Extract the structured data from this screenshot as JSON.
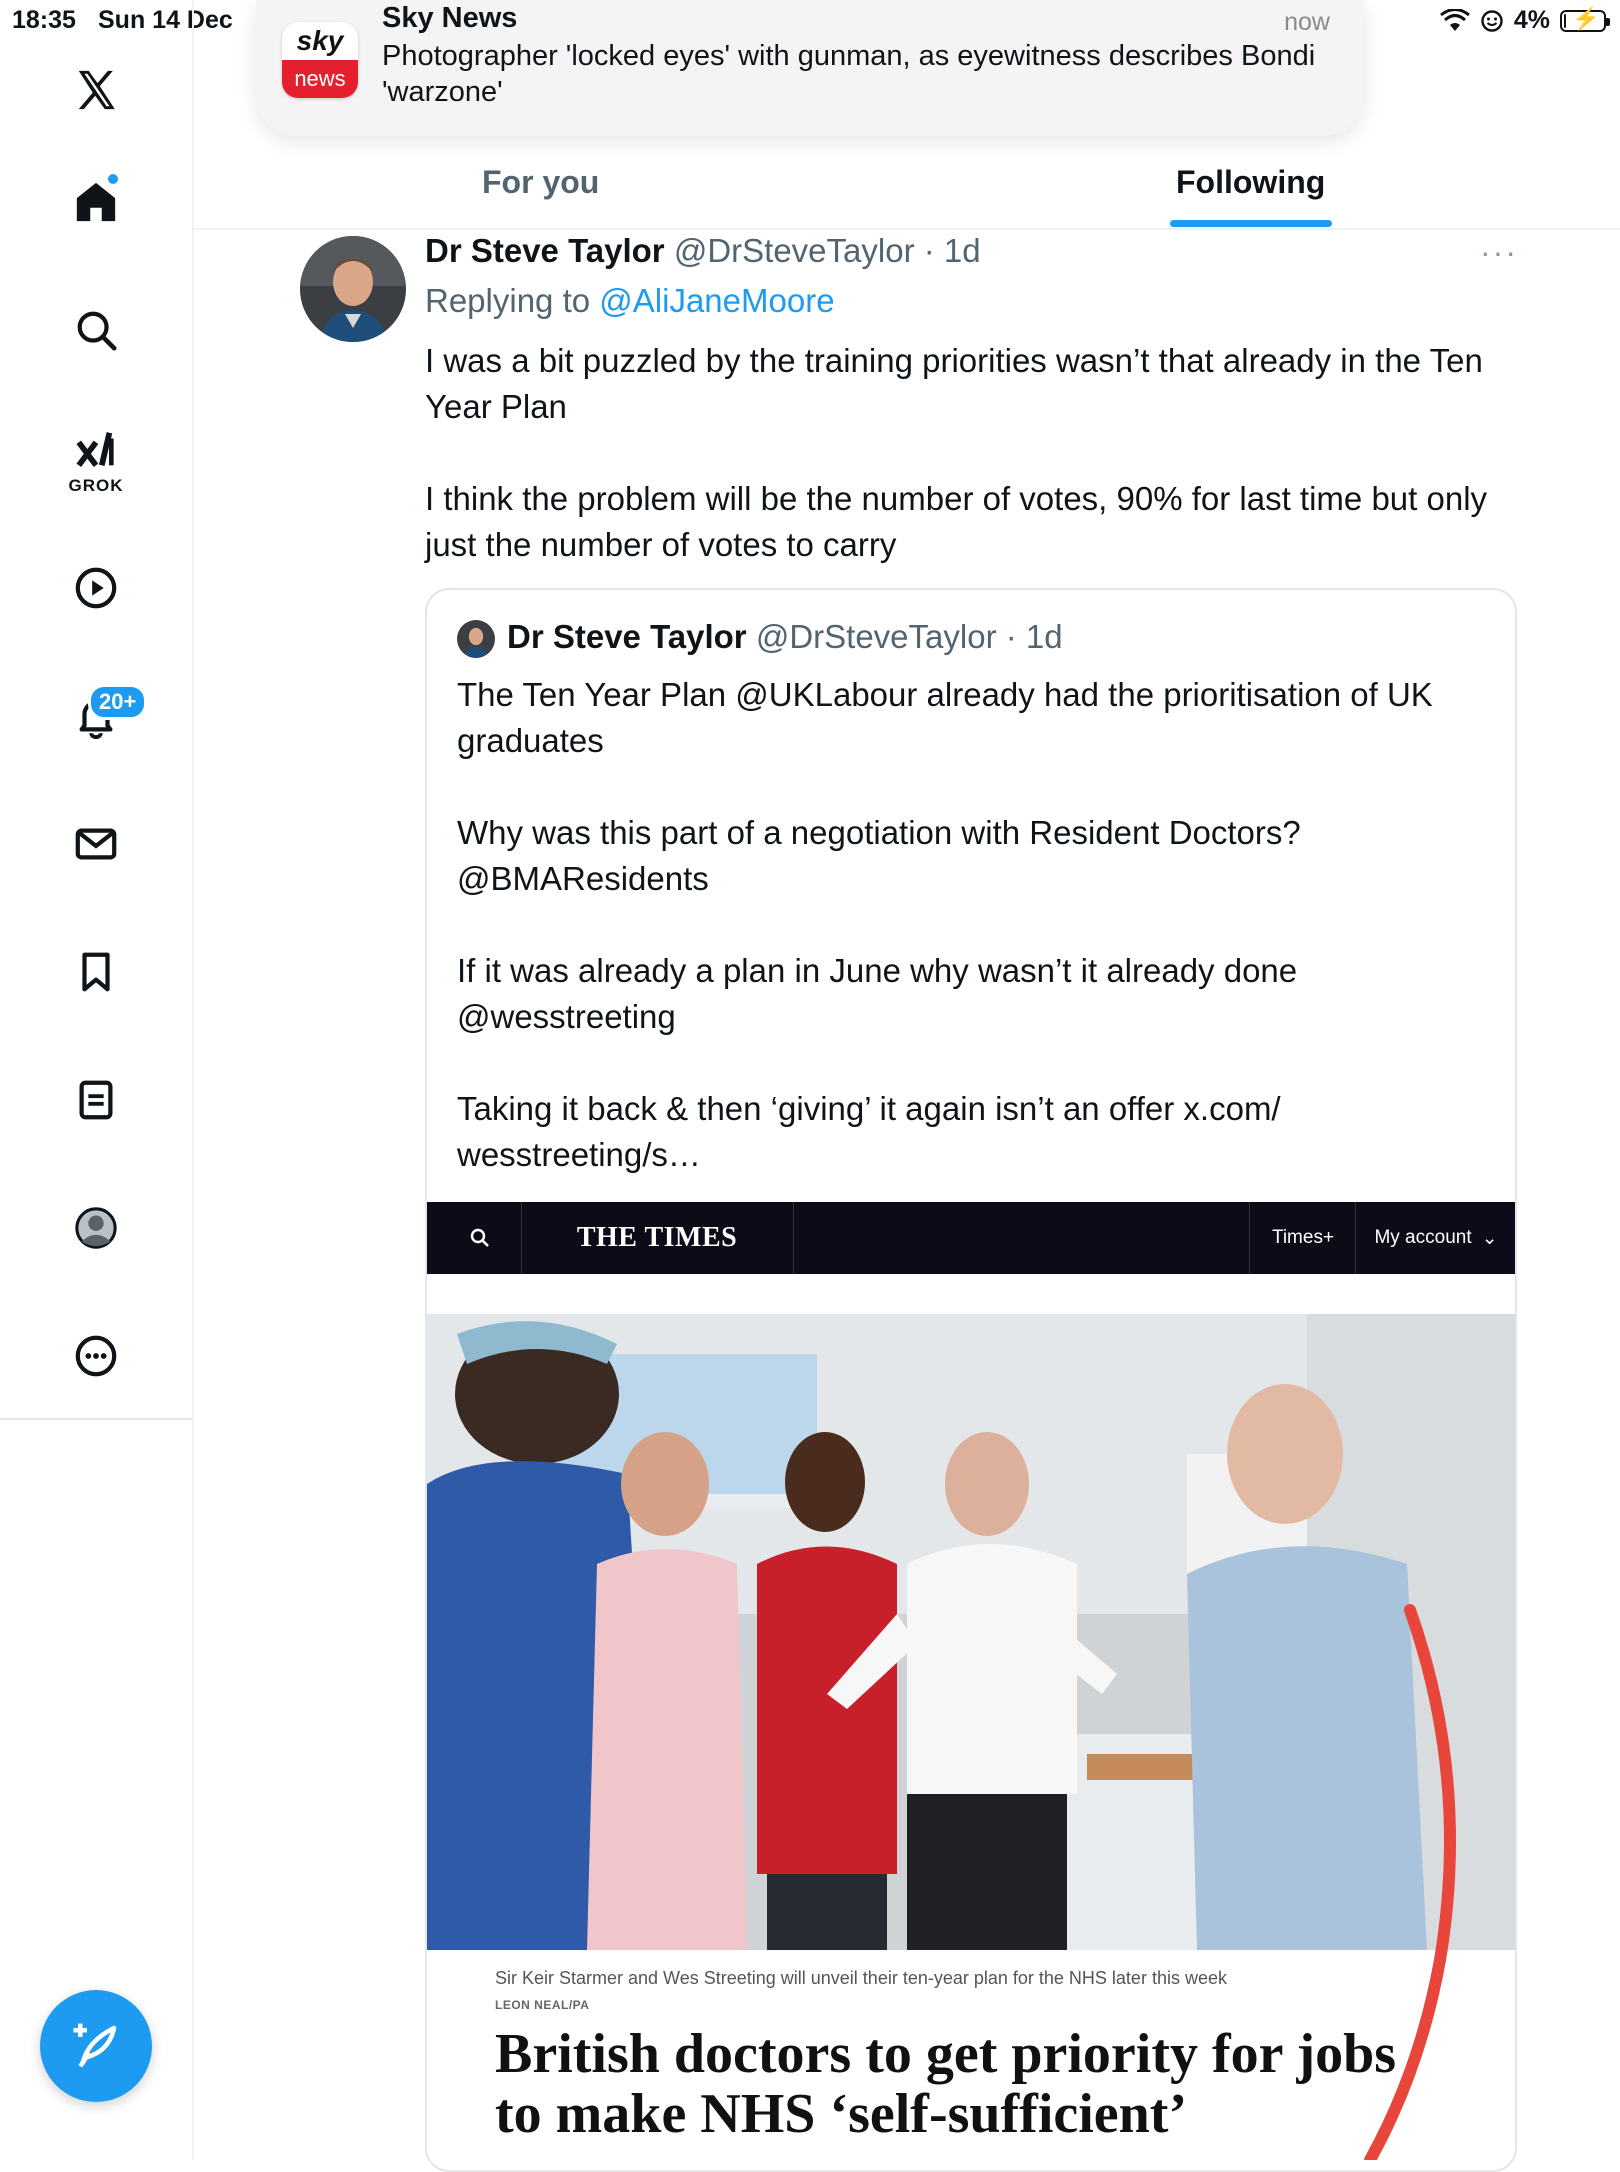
{
  "status_bar": {
    "time": "18:35",
    "date": "Sun 14 Dec",
    "battery": "4%",
    "battery_level": 0.04
  },
  "notification": {
    "app": "Sky News",
    "logo_top": "sky",
    "logo_bottom": "news",
    "time": "now",
    "body": "Photographer 'locked eyes' with gunman, as eyewitness describes Bondi 'warzone'"
  },
  "sidebar": {
    "grok_label": "GROK",
    "notifications_badge": "20+",
    "items": [
      "x-logo",
      "home",
      "explore",
      "grok",
      "video",
      "notifications",
      "messages",
      "bookmarks",
      "lists",
      "profile",
      "more"
    ]
  },
  "tabs": {
    "for_you": "For you",
    "following": "Following",
    "active": "Following"
  },
  "tweet": {
    "author_name": "Dr Steve Taylor",
    "handle": "@DrSteveTaylor",
    "time": "· 1d",
    "replying_to_label": "Replying to",
    "replying_to": "@AliJaneMoore",
    "text": "I was a bit puzzled by the training priorities wasn’t that already in the Ten Year Plan\n\nI think the problem will be the number of votes, 90% for last time but only just the number of votes to carry",
    "more": "···"
  },
  "quote": {
    "author_name": "Dr Steve Taylor",
    "handle": "@DrSteveTaylor",
    "time": "· 1d",
    "text": "The Ten Year Plan @UKLabour already had the prioritisation of UK graduates\n\nWhy was this part of a negotiation with Resident Doctors? @BMAResidents\n\nIf it was already a plan in June why wasn’t it already done @wesstreeting\n\nTaking it back & then ‘giving’ it again isn’t an offer x.com/\nwesstreeting/s…"
  },
  "article": {
    "site_logo": "THE TIMES",
    "nav_plus": "Times+",
    "nav_account": "My account",
    "caption": "Sir Keir Starmer and Wes Streeting will unveil their ten-year plan for the NHS later this week",
    "credit": "LEON NEAL/PA",
    "headline": "British doctors to get priority for jobs to make NHS ‘self-sufficient’"
  },
  "colors": {
    "accent": "#1d9bf0",
    "text": "#0f1419",
    "muted": "#536471",
    "annotation": "#e8463a",
    "sky_red": "#e4202e"
  }
}
